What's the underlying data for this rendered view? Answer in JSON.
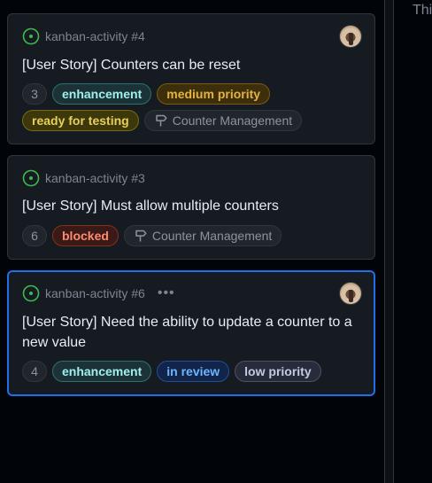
{
  "next_column": {
    "partial_text": "Thi"
  },
  "cards": [
    {
      "issue_ref": "kanban-activity #4",
      "title": "[User Story] Counters can be reset",
      "count": "3",
      "labels": [
        "enhancement",
        "medium priority",
        "ready for testing"
      ],
      "milestone": "Counter Management",
      "has_avatar": true
    },
    {
      "issue_ref": "kanban-activity #3",
      "title": "[User Story] Must allow multiple counters",
      "count": "6",
      "labels": [
        "blocked"
      ],
      "milestone": "Counter Management",
      "has_avatar": false
    },
    {
      "issue_ref": "kanban-activity #6",
      "more_menu": "•••",
      "title": "[User Story] Need the ability to update a counter to a new value",
      "count": "4",
      "labels": [
        "enhancement",
        "in review",
        "low priority"
      ],
      "has_avatar": true,
      "selected": true
    }
  ],
  "colors": {
    "open_status": "#3fb950",
    "selected_border": "#1f6feb",
    "card_bg": "#161b22"
  },
  "icons": {
    "status": "issue-opened-icon",
    "milestone": "milestone-icon",
    "more": "kebab-horizontal-icon"
  }
}
